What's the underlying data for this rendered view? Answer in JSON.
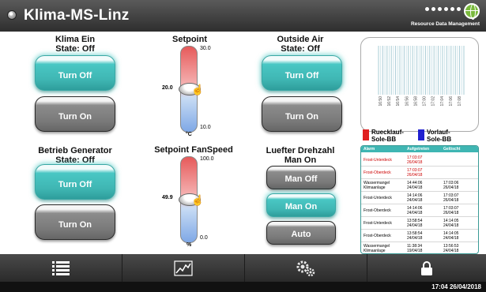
{
  "header": {
    "title": "Klima-MS-Linz",
    "logo_text": "Resource Data Management"
  },
  "klima": {
    "title": "Klima Ein",
    "state": "State: Off",
    "btn_off": "Turn Off",
    "btn_on": "Turn On"
  },
  "generator": {
    "title": "Betrieb Generator",
    "state": "State: Off",
    "btn_off": "Turn Off",
    "btn_on": "Turn On"
  },
  "setpoint": {
    "title": "Setpoint",
    "max": "30.0",
    "min": "10.0",
    "value": "20.0",
    "unit": "°C",
    "level": 0.5
  },
  "fanspeed": {
    "title": "Setpoint FanSpeed",
    "max": "100.0",
    "min": "0.0",
    "value": "49.9",
    "unit": "%",
    "level": 0.499
  },
  "outside_air": {
    "title": "Outside Air",
    "state": "State: Off",
    "btn_off": "Turn Off",
    "btn_on": "Turn On"
  },
  "luefter": {
    "title": "Luefter Drehzahl",
    "state": "Man On",
    "btn_man_off": "Man Off",
    "btn_man_on": "Man On",
    "btn_auto": "Auto"
  },
  "trend": {
    "legend": [
      "Ruecklauf-Sole-BB",
      "Vorlauf-Sole-BB"
    ],
    "legend_line1": [
      "Ruecklauf-",
      "Vorlauf-"
    ],
    "legend_line2": [
      "Sole-BB",
      "Sole-BB"
    ],
    "colors": {
      "ruecklauf": "#e02020",
      "vorlauf": "#2020d0"
    },
    "x_ticks": [
      "16:50",
      "16:52",
      "16:54",
      "16:56",
      "16:58",
      "17:00",
      "17:02",
      "17:04",
      "17:06",
      "17:08"
    ]
  },
  "alarms": {
    "columns": [
      "Alarm",
      "Aufgetreten",
      "Gelöscht"
    ],
    "rows": [
      {
        "alarm": "Frost-Unterdeck",
        "occurred": [
          "17:03:07",
          "26/04/18"
        ],
        "cleared": [
          "",
          ""
        ],
        "active": true
      },
      {
        "alarm": "Frost-Oberdeck",
        "occurred": [
          "17:03:07",
          "26/04/18"
        ],
        "cleared": [
          "",
          ""
        ],
        "active": true
      },
      {
        "alarm": [
          "Wassermangel",
          "Klimaanlage"
        ],
        "occurred": [
          "14:44:06",
          "24/04/18"
        ],
        "cleared": [
          "17:03:06",
          "26/04/18"
        ],
        "active": false
      },
      {
        "alarm": "Frost-Unterdeck",
        "occurred": [
          "14:14:06",
          "24/04/18"
        ],
        "cleared": [
          "17:03:07",
          "26/04/18"
        ],
        "active": false
      },
      {
        "alarm": "Frost-Oberdeck",
        "occurred": [
          "14:14:06",
          "24/04/18"
        ],
        "cleared": [
          "17:03:07",
          "26/04/18"
        ],
        "active": false
      },
      {
        "alarm": "Frost-Unterdeck",
        "occurred": [
          "13:58:54",
          "24/04/18"
        ],
        "cleared": [
          "14:14:05",
          "24/04/18"
        ],
        "active": false
      },
      {
        "alarm": "Frost-Oberdeck",
        "occurred": [
          "13:58:54",
          "24/04/18"
        ],
        "cleared": [
          "14:14:05",
          "24/04/18"
        ],
        "active": false
      },
      {
        "alarm": [
          "Wassermangel",
          "Klimaanlage"
        ],
        "occurred": [
          "11:38:34",
          "19/04/18"
        ],
        "cleared": [
          "13:56:53",
          "24/04/18"
        ],
        "active": false
      }
    ]
  },
  "nav": {
    "items": [
      "list-icon",
      "trend-chart-icon",
      "settings-gears-icon",
      "lock-icon"
    ]
  },
  "status": {
    "datetime": "17:04 26/04/2018"
  },
  "colors": {
    "accent_teal": "#3fb6b3",
    "button_gray": "#7a7a7a",
    "alarm_active_red": "#cc0000"
  }
}
